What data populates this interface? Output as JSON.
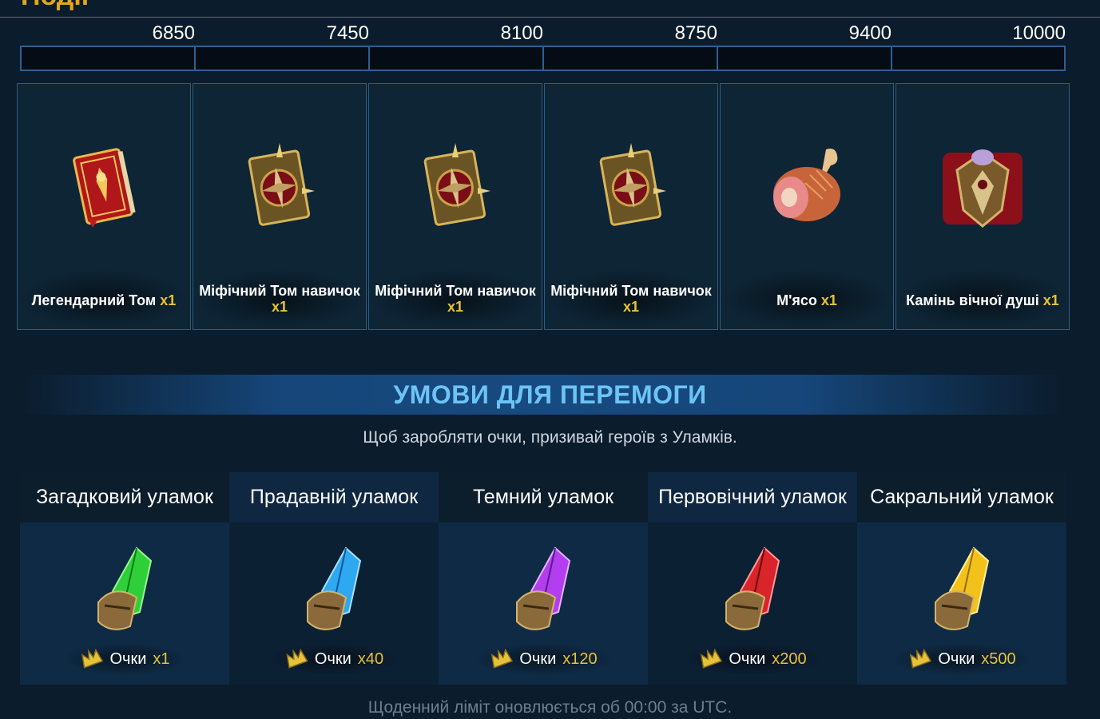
{
  "page": {
    "title": "Події"
  },
  "progress": {
    "ticks": [
      "6850",
      "7450",
      "8100",
      "8750",
      "9400",
      "10000"
    ]
  },
  "rewards": [
    {
      "name": "Легендарний Том",
      "qty": "x1",
      "icon": "legendary-tome-icon"
    },
    {
      "name": "Міфічний Том навичок",
      "qty": "x1",
      "icon": "mythical-skill-tome-icon"
    },
    {
      "name": "Міфічний Том навичок",
      "qty": "x1",
      "icon": "mythical-skill-tome-icon"
    },
    {
      "name": "Міфічний Том навичок",
      "qty": "x1",
      "icon": "mythical-skill-tome-icon"
    },
    {
      "name": "М'ясо",
      "qty": "x1",
      "icon": "meat-icon"
    },
    {
      "name": "Камінь вічної душі",
      "qty": "x1",
      "icon": "eternal-soul-stone-icon"
    }
  ],
  "conditions": {
    "title": "УМОВИ ДЛЯ ПЕРЕМОГИ",
    "subtitle": "Щоб заробляти очки, призивай героїв з Уламків."
  },
  "shards": [
    {
      "name": "Загадковий уламок",
      "points_label": "Очки",
      "points": "x1",
      "color": "#2fcf3a"
    },
    {
      "name": "Прадавній уламок",
      "points_label": "Очки",
      "points": "x40",
      "color": "#2ea8f0"
    },
    {
      "name": "Темний уламок",
      "points_label": "Очки",
      "points": "x120",
      "color": "#b33df0"
    },
    {
      "name": "Первовічний уламок",
      "points_label": "Очки",
      "points": "x200",
      "color": "#d8242a"
    },
    {
      "name": "Сакральний уламок",
      "points_label": "Очки",
      "points": "x500",
      "color": "#f2c21a"
    }
  ],
  "footer": {
    "note": "Щоденний ліміт оновлюється об 00:00 за UTC."
  }
}
